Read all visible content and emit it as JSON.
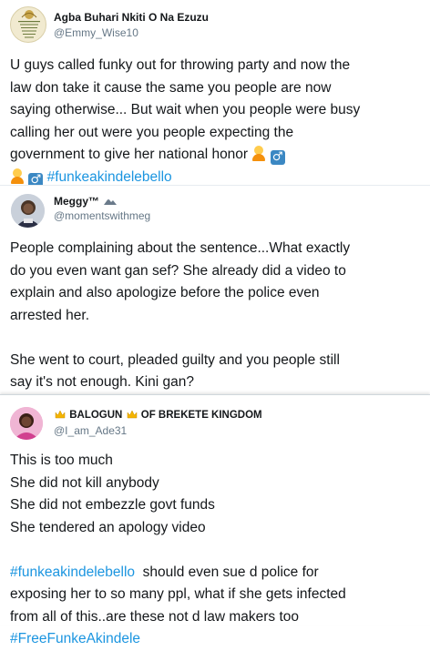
{
  "tweets": [
    {
      "name": "Agba Buhari Nkiti O Na Ezuzu",
      "handle": "@Emmy_Wise10",
      "body_lines": [
        "U guys called funky out for throwing party and now the",
        "law don take it cause the same you people are now",
        "saying otherwise... But wait when you people were busy",
        "calling her out were you people expecting the",
        "government to give her national honor"
      ],
      "hashtag": "#funkeakindelebello"
    },
    {
      "name": "Meggy™",
      "handle": "@momentswithmeg",
      "paragraph1": [
        "People complaining about the sentence...What exactly",
        "do you even want gan sef? She already did a video to",
        "explain and also apologize before the police even",
        "arrested her."
      ],
      "paragraph2": [
        "She went to court, pleaded guilty and you people still",
        "say it's not enough. Kini gan?"
      ]
    },
    {
      "name_left": "BALOGUN",
      "name_right": "OF BREKETE KINGDOM",
      "handle": "@I_am_Ade31",
      "lines": [
        "This is too much",
        "She did not kill anybody",
        "She did not embezzle govt funds",
        "She tendered an apology video"
      ],
      "hashtag_line_tag": "#funkeakindelebello",
      "hashtag_line_rest": "  should even sue d police for",
      "line_after": [
        "exposing her to so many ppl, what if she gets infected",
        "from all of this..are these not d law makers too"
      ],
      "final_hashtag": "#FreeFunkeAkindele"
    }
  ],
  "avatar1_text": [
    "Committed to",
    "The Best Worthless For",
    "Of Our Country",
    "To the People",
    "On Earth",
    "Next Week"
  ],
  "colors": {
    "hashtag": "#1b95e0",
    "handle": "#657786",
    "text": "#14171a"
  },
  "icons": [
    "person-shrugging-emoji",
    "male-sign-emoji",
    "crown-emoji",
    "mountain-emoji"
  ]
}
